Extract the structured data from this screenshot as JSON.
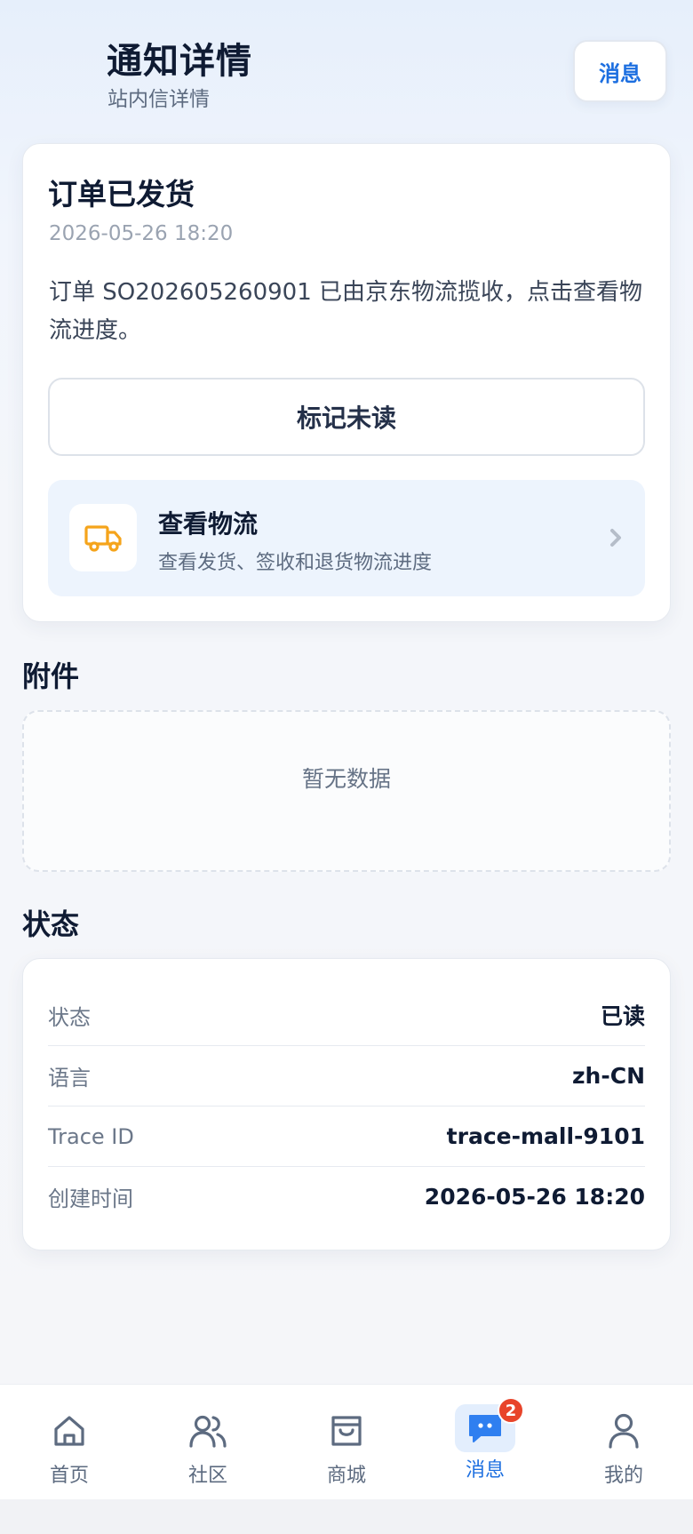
{
  "header": {
    "title": "通知详情",
    "subtitle": "站内信详情",
    "messages_button": "消息"
  },
  "notice": {
    "title": "订单已发货",
    "time": "2026-05-26 18:20",
    "body": "订单 SO202605260901 已由京东物流揽收，点击查看物流进度。",
    "mark_unread_button": "标记未读",
    "logistics": {
      "title": "查看物流",
      "subtitle": "查看发货、签收和退货物流进度",
      "icon": "truck-icon",
      "icon_color": "#f5a41b"
    }
  },
  "attachments": {
    "section_title": "附件",
    "empty_text": "暂无数据"
  },
  "status": {
    "section_title": "状态",
    "rows": [
      {
        "label": "状态",
        "value": "已读"
      },
      {
        "label": "语言",
        "value": "zh-CN"
      },
      {
        "label": "Trace ID",
        "value": "trace-mall-9101"
      },
      {
        "label": "创建时间",
        "value": "2026-05-26 18:20"
      }
    ]
  },
  "tabbar": {
    "items": [
      {
        "label": "首页",
        "icon": "home-icon"
      },
      {
        "label": "社区",
        "icon": "community-icon"
      },
      {
        "label": "商城",
        "icon": "shop-bag-icon"
      },
      {
        "label": "消息",
        "icon": "message-icon",
        "badge": "2",
        "active": true
      },
      {
        "label": "我的",
        "icon": "profile-icon"
      }
    ]
  },
  "colors": {
    "accent": "#1d6fe0",
    "badge": "#e8442a",
    "text_primary": "#0f1b33",
    "text_secondary": "#5d6b80"
  }
}
